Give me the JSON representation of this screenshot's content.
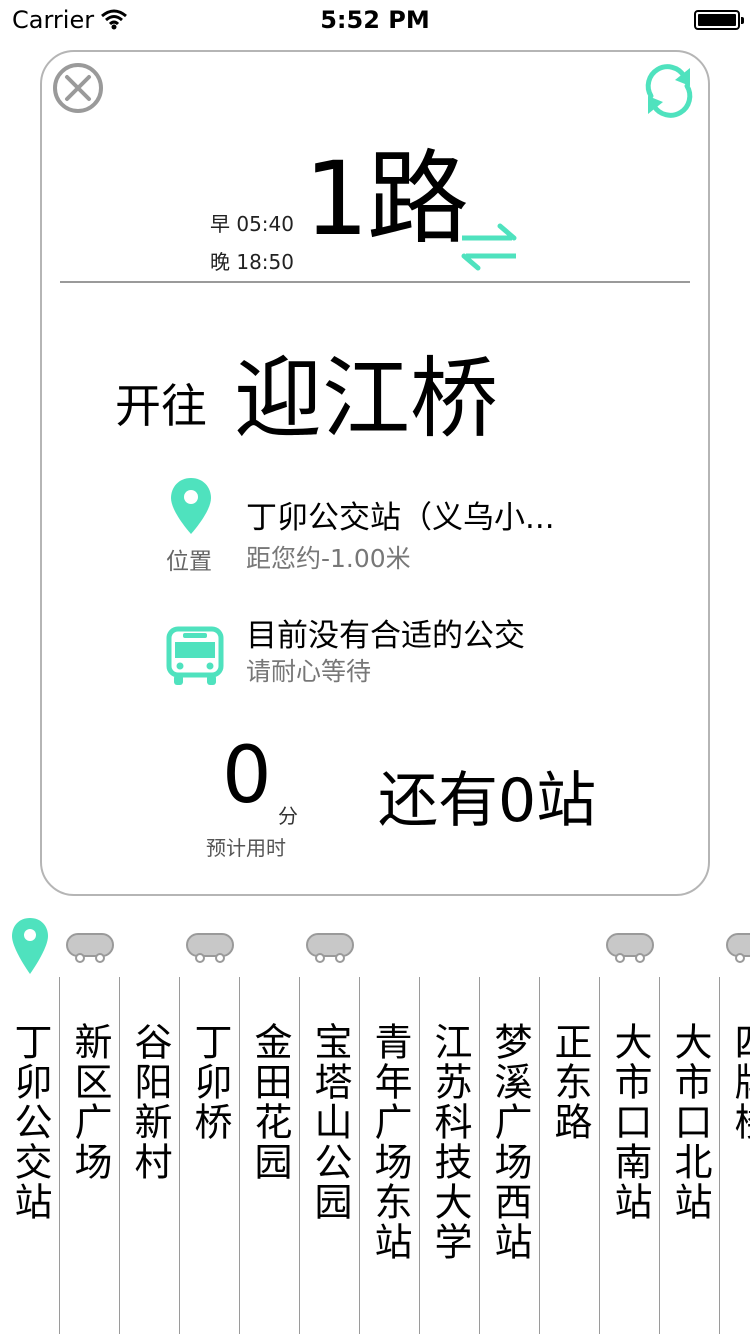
{
  "status_bar": {
    "carrier": "Carrier",
    "time": "5:52 PM"
  },
  "route": {
    "number": "1路",
    "first_bus": "早 05:40",
    "last_bus": "晚 18:50"
  },
  "direction": {
    "label": "开往",
    "destination": "迎江桥"
  },
  "location": {
    "icon_label": "位置",
    "stop_name": "丁卯公交站（义乌小...",
    "distance": "距您约-1.00米"
  },
  "bus": {
    "status": "目前没有合适的公交",
    "wait": "请耐心等待"
  },
  "eta": {
    "minutes": "0",
    "unit": "分",
    "label": "预计用时",
    "stops_remaining": "还有0站"
  },
  "colors": {
    "accent": "#4fe2be",
    "gray_icon": "#c8c8c8",
    "border": "#b5b5b5"
  },
  "stations": [
    {
      "name": "丁卯公交站",
      "marker": "location-pin"
    },
    {
      "name": "新区广场",
      "marker": "bus"
    },
    {
      "name": "谷阳新村",
      "marker": ""
    },
    {
      "name": "丁卯桥",
      "marker": "bus"
    },
    {
      "name": "金田花园",
      "marker": ""
    },
    {
      "name": "宝塔山公园",
      "marker": "bus"
    },
    {
      "name": "青年广场东站",
      "marker": ""
    },
    {
      "name": "江苏科技大学",
      "marker": ""
    },
    {
      "name": "梦溪广场西站",
      "marker": ""
    },
    {
      "name": "正东路",
      "marker": ""
    },
    {
      "name": "大市口南站",
      "marker": "bus"
    },
    {
      "name": "大市口北站",
      "marker": ""
    },
    {
      "name": "四牌楼",
      "marker": "bus"
    }
  ]
}
